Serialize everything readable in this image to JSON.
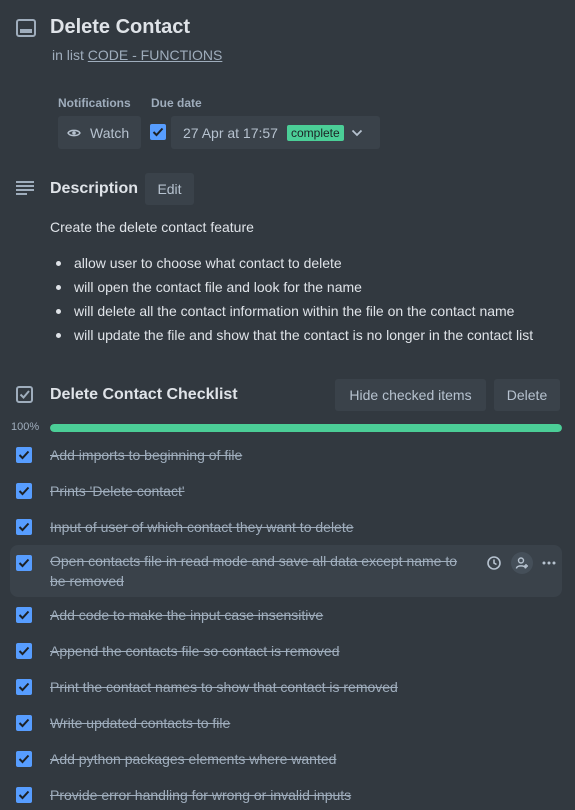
{
  "card": {
    "title": "Delete Contact",
    "in_list_prefix": "in list",
    "list_name": "CODE - FUNCTIONS"
  },
  "notifications": {
    "label": "Notifications",
    "watch_label": "Watch"
  },
  "due_date": {
    "label": "Due date",
    "checked": true,
    "value": "27 Apr at 17:57",
    "status": "complete"
  },
  "description": {
    "title": "Description",
    "edit_label": "Edit",
    "text": "Create the delete contact feature",
    "bullets": [
      "allow user to choose what contact to delete",
      "will open the contact file and look for the name",
      "will delete all the contact information within the file on the contact name",
      "will update the file and show that the contact is no longer in the contact list"
    ]
  },
  "checklist": {
    "title": "Delete Contact Checklist",
    "hide_label": "Hide checked items",
    "delete_label": "Delete",
    "progress_label": "100%",
    "progress": 1.0,
    "items": [
      "Add imports to beginning of file",
      "Prints 'Delete contact'",
      "Input of user of which contact they want to delete",
      "Open contacts file in read mode and save all data except name to be removed",
      "Add code to make the input case insensitive",
      "Append the contacts file so contact is removed",
      "Print the contact names to show that contact is removed",
      "Write updated contacts to file",
      "Add python packages elements where wanted",
      "Provide error handling for wrong or invalid inputs"
    ]
  },
  "colors": {
    "background": "#323940",
    "accent": "#579dff",
    "success": "#4bce97"
  },
  "icons": [
    "card-icon",
    "eye-icon",
    "checkmark-icon",
    "chevron-down-icon",
    "description-icon",
    "checklist-icon",
    "clock-icon",
    "assign-member-icon",
    "more-icon"
  ]
}
